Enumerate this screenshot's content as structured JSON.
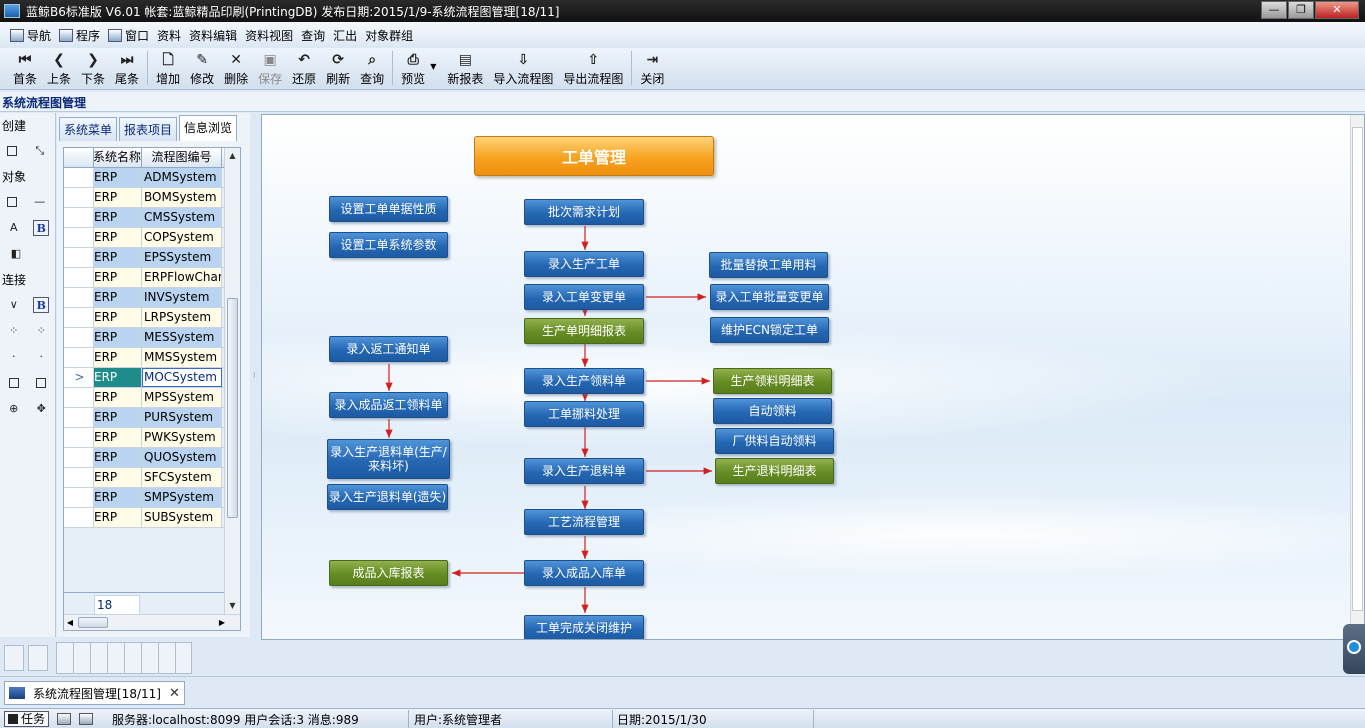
{
  "window": {
    "title": "蓝鲸B6标准版 V6.01 帐套:蓝鲸精品印刷(PrintingDB) 发布日期:2015/1/9-系统流程图管理[18/11]",
    "buttons": {
      "minimize": "—",
      "maximize": "❐",
      "close": "✕"
    }
  },
  "menu": {
    "items": [
      {
        "label": "导航",
        "icon": "navigation-icon"
      },
      {
        "label": "程序",
        "icon": "program-icon"
      },
      {
        "label": "窗口",
        "icon": "window-icon"
      },
      {
        "label": "资料"
      },
      {
        "label": "资料编辑"
      },
      {
        "label": "资料视图"
      },
      {
        "label": "查询"
      },
      {
        "label": "汇出"
      },
      {
        "label": "对象群组"
      }
    ]
  },
  "toolbar": {
    "first": "首条",
    "prev": "上条",
    "next": "下条",
    "last": "尾条",
    "add": "增加",
    "edit": "修改",
    "delete": "删除",
    "save": "保存",
    "undo": "还原",
    "refresh": "刷新",
    "query": "查询",
    "preview": "预览",
    "new_report": "新报表",
    "import_flow": "导入流程图",
    "export_flow": "导出流程图",
    "close": "关闭"
  },
  "module_title": "系统流程图管理",
  "palette": {
    "create": "创建",
    "object": "对象",
    "connect": "连接"
  },
  "tabs": [
    "系统菜单",
    "报表项目",
    "信息浏览"
  ],
  "grid": {
    "headers": [
      "",
      "系统名称",
      "流程图编号"
    ],
    "rows": [
      {
        "system": "ERP",
        "code": "ADMSystem"
      },
      {
        "system": "ERP",
        "code": "BOMSystem"
      },
      {
        "system": "ERP",
        "code": "CMSSystem"
      },
      {
        "system": "ERP",
        "code": "COPSystem"
      },
      {
        "system": "ERP",
        "code": "EPSSystem"
      },
      {
        "system": "ERP",
        "code": "ERPFlowChart"
      },
      {
        "system": "ERP",
        "code": "INVSystem"
      },
      {
        "system": "ERP",
        "code": "LRPSystem"
      },
      {
        "system": "ERP",
        "code": "MESSystem"
      },
      {
        "system": "ERP",
        "code": "MMSSystem"
      },
      {
        "system": "ERP",
        "code": "MOCSystem",
        "selected": true
      },
      {
        "system": "ERP",
        "code": "MPSSystem"
      },
      {
        "system": "ERP",
        "code": "PURSystem"
      },
      {
        "system": "ERP",
        "code": "PWKSystem"
      },
      {
        "system": "ERP",
        "code": "QUOSystem"
      },
      {
        "system": "ERP",
        "code": "SFCSystem"
      },
      {
        "system": "ERP",
        "code": "SMPSystem"
      },
      {
        "system": "ERP",
        "code": "SUBSystem"
      }
    ],
    "row_marker": ">",
    "count": "18"
  },
  "flow": {
    "title": "工单管理",
    "nodes": {
      "n_set_attr": "设置工单单据性质",
      "n_set_param": "设置工单系统参数",
      "n_batch_plan": "批次需求计划",
      "n_enter_mo": "录入生产工单",
      "n_mo_change": "录入工单变更单",
      "n_mo_detail": "生产单明细报表",
      "n_batch_replace": "批量替换工单用料",
      "n_batch_change": "录入工单批量变更单",
      "n_ecn_lock": "维护ECN锁定工单",
      "n_rework_notice": "录入返工通知单",
      "n_rework_issue": "录入成品返工领料单",
      "n_return_mat": "录入生产退料单(生产/来料坏)",
      "n_return_lost": "录入生产退料单(遗失)",
      "n_issue": "录入生产领料单",
      "n_issue_detail": "生产领料明细表",
      "n_auto_issue": "自动领料",
      "n_vendor_issue": "厂供料自动领料",
      "n_transfer": "工单挪料处理",
      "n_return": "录入生产退料单",
      "n_return_detail": "生产退料明细表",
      "n_routing": "工艺流程管理",
      "n_receipt": "录入成品入库单",
      "n_receipt_report": "成品入库报表",
      "n_close": "工单完成关闭维护"
    }
  },
  "doc_tab": {
    "label": "系统流程图管理[18/11]",
    "close": "✕"
  },
  "status": {
    "task": "任务",
    "server": "服务器:localhost:8099 用户会话:3 消息:989",
    "user": "用户:系统管理者",
    "date": "日期:2015/1/30"
  },
  "colors": {
    "node_blue": "#2567b3",
    "node_green": "#668c24",
    "header_orange": "#f7a21f",
    "connector_red": "#d21f1f"
  }
}
